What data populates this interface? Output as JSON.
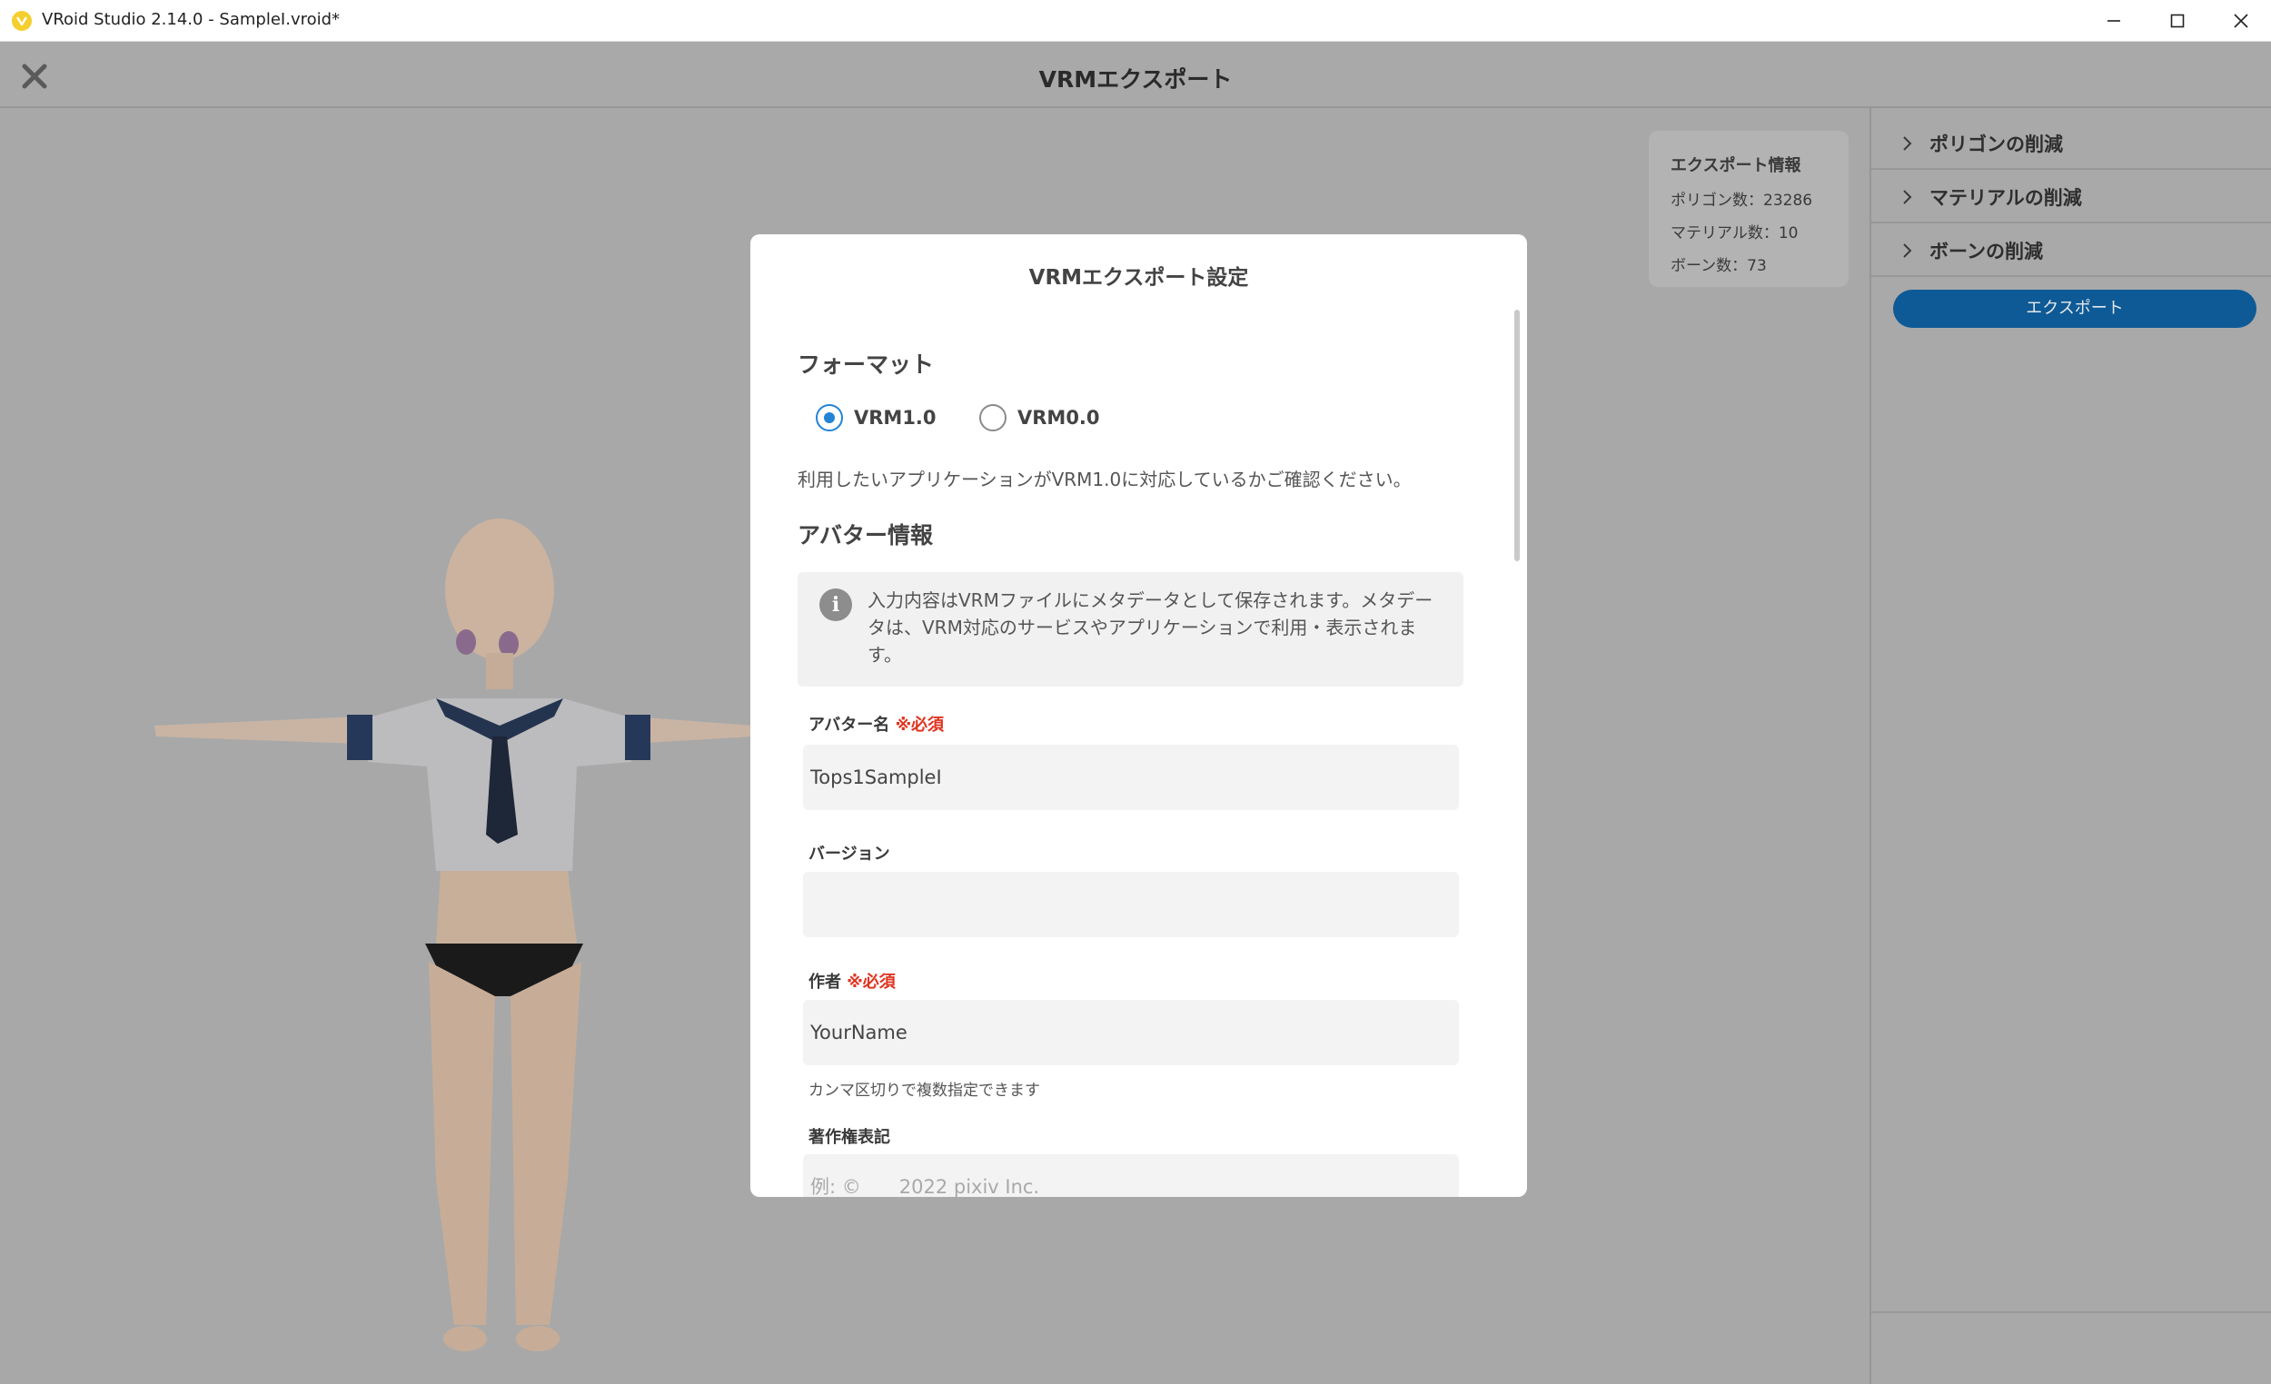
{
  "window": {
    "title": "VRoid Studio 2.14.0 - SampleI.vroid*",
    "icon": "vroid-app-icon",
    "controls": [
      "minimize-icon",
      "maximize-icon",
      "close-icon"
    ]
  },
  "header": {
    "title": "VRMエクスポート",
    "close_icon": "close-icon"
  },
  "export_info": {
    "heading": "エクスポート情報",
    "polygons": "ポリゴン数：23286",
    "materials": "マテリアル数：10",
    "bones": "ボーン数：73"
  },
  "right_panel": {
    "items": [
      {
        "label": "ポリゴンの削減"
      },
      {
        "label": "マテリアルの削減"
      },
      {
        "label": "ボーンの削減"
      }
    ],
    "export_button": "エクスポート"
  },
  "dialog": {
    "title": "VRMエクスポート設定",
    "format": {
      "heading": "フォーマット",
      "options": [
        "VRM1.0",
        "VRM0.0"
      ],
      "selected": "VRM1.0",
      "note": "利用したいアプリケーションがVRM1.0に対応しているかご確認ください。"
    },
    "avatar": {
      "heading": "アバター情報",
      "info": "入力内容はVRMファイルにメタデータとして保存されます。メタデータは、VRM対応のサービスやアプリケーションで利用・表示されます。",
      "required_mark": "※必須",
      "name_label": "アバター名",
      "name_value": "Tops1SampleI",
      "version_label": "バージョン",
      "version_value": "",
      "author_label": "作者",
      "author_value": "YourName",
      "author_hint": "カンマ区切りで複数指定できます",
      "copyright_label": "著作権表記",
      "copyright_placeholder": "例: ©　　2022 pixiv Inc."
    }
  },
  "colors": {
    "accent": "#2383d6",
    "required": "#e0331f",
    "export_button": "#0d5a96",
    "overlay": "#a8a8a8"
  }
}
